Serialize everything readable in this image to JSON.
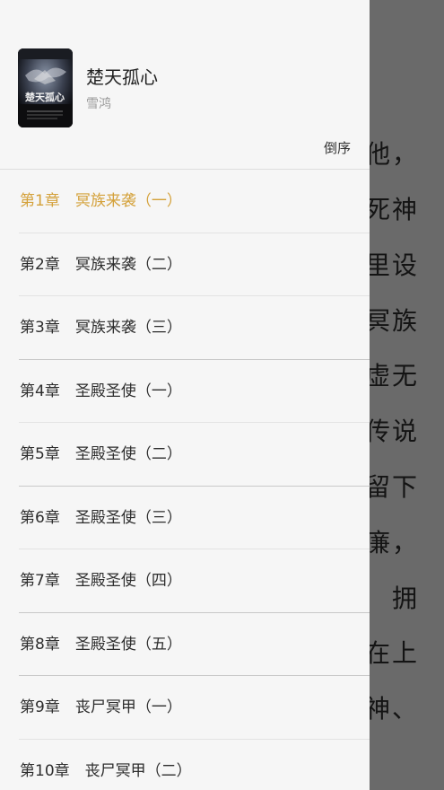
{
  "reader": {
    "lines": [
      "他，",
      "死神",
      "里设",
      "冥族",
      "虚无",
      "传说",
      "留下",
      "廉，",
      "拥",
      "在上",
      "神、"
    ]
  },
  "book": {
    "title": "楚天孤心",
    "author": "雪鸿",
    "cover_title": "楚天孤心"
  },
  "toolbar": {
    "sort_label": "倒序"
  },
  "chapters": [
    {
      "label": "第1章　冥族来袭（一）"
    },
    {
      "label": "第2章　冥族来袭（二）"
    },
    {
      "label": "第3章　冥族来袭（三）"
    },
    {
      "label": "第4章　圣殿圣使（一）"
    },
    {
      "label": "第5章　圣殿圣使（二）"
    },
    {
      "label": "第6章　圣殿圣使（三）"
    },
    {
      "label": "第7章　圣殿圣使（四）"
    },
    {
      "label": "第8章　圣殿圣使（五）"
    },
    {
      "label": "第9章　丧尸冥甲（一）"
    },
    {
      "label": "第10章　丧尸冥甲（二）"
    }
  ],
  "colors": {
    "accent": "#d4a13a",
    "drawer_bg": "#f6f6f6",
    "overlay": "#6a6a6a"
  }
}
